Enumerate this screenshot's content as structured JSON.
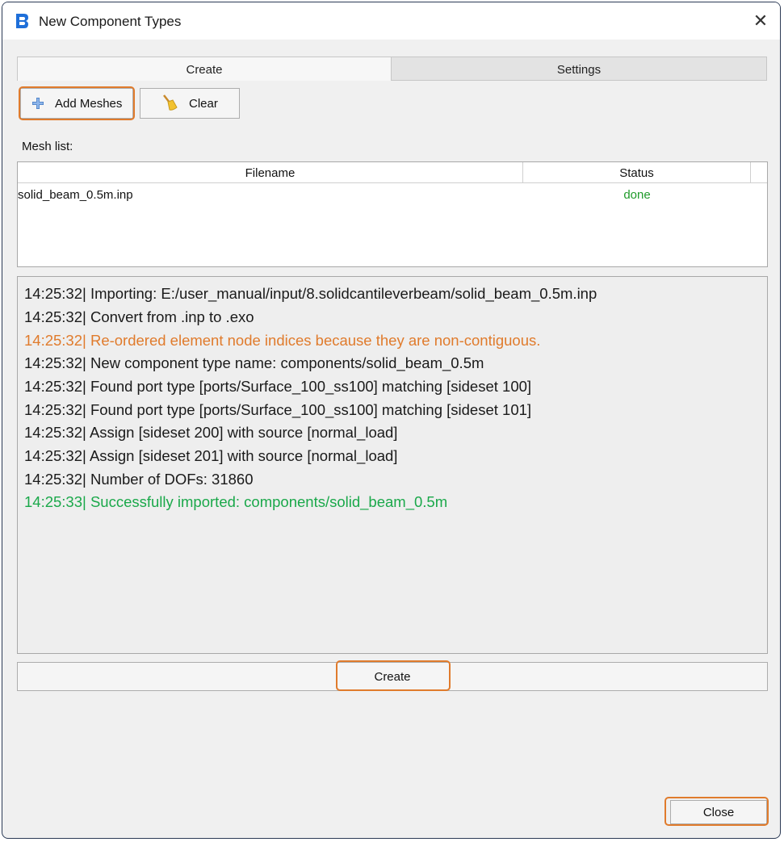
{
  "window": {
    "title": "New Component Types",
    "close_glyph": "✕",
    "app_icon": "app-logo-icon"
  },
  "tabs": [
    {
      "label": "Create",
      "active": true
    },
    {
      "label": "Settings",
      "active": false
    }
  ],
  "toolbar": {
    "add_meshes_label": "Add Meshes",
    "add_meshes_icon": "plus-icon",
    "clear_label": "Clear",
    "clear_icon": "broom-icon"
  },
  "mesh_list": {
    "label": "Mesh list:",
    "columns": [
      "Filename",
      "Status"
    ],
    "rows": [
      {
        "filename": "solid_beam_0.5m.inp",
        "status": "done"
      }
    ]
  },
  "log": {
    "lines": [
      {
        "text": "14:25:32| Importing: E:/user_manual/input/8.solidcantileverbeam/solid_beam_0.5m.inp",
        "color": "#1a1a1a"
      },
      {
        "text": "14:25:32| Convert from .inp to .exo",
        "color": "#1a1a1a"
      },
      {
        "text": "14:25:32| Re-ordered element node indices because they are non-contiguous.",
        "color": "#e07b2c"
      },
      {
        "text": "14:25:32| New component type name: components/solid_beam_0.5m",
        "color": "#1a1a1a"
      },
      {
        "text": "14:25:32| Found port type [ports/Surface_100_ss100] matching [sideset 100]",
        "color": "#1a1a1a"
      },
      {
        "text": "14:25:32| Found port type [ports/Surface_100_ss100] matching [sideset 101]",
        "color": "#1a1a1a"
      },
      {
        "text": "14:25:32| Assign [sideset 200] with source [normal_load]",
        "color": "#1a1a1a"
      },
      {
        "text": "14:25:32| Assign [sideset 201] with source [normal_load]",
        "color": "#1a1a1a"
      },
      {
        "text": "14:25:32| Number of DOFs: 31860",
        "color": "#1a1a1a"
      },
      {
        "text": "14:25:33| Successfully imported: components/solid_beam_0.5m",
        "color": "#1aa84a"
      }
    ]
  },
  "actions": {
    "create_label": "Create",
    "close_label": "Close"
  },
  "colors": {
    "highlight": "#e07b2c",
    "status_done": "#1f9a2a",
    "accent": "#1e6fd9"
  }
}
